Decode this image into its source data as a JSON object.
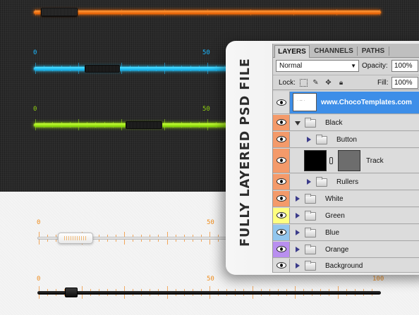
{
  "colors": {
    "orange": "#ff7a10",
    "blue": "#19c0ff",
    "green": "#a6f000",
    "white_track": "#ffffff",
    "black_track": "#000000",
    "selected_layer": "#3d8ee8",
    "eye_orange": "#f49a6a",
    "eye_yellow": "#ffff80",
    "eye_blue": "#92c6ee",
    "eye_purple": "#b98ff0",
    "eye_gray": "#dcdcdc"
  },
  "sliders": {
    "orange": {
      "value_fraction": 0.03,
      "labels": []
    },
    "blue": {
      "labels": [
        "0",
        "50"
      ],
      "value_fraction": 0.16
    },
    "green": {
      "labels": [
        "0",
        "50"
      ],
      "value_fraction": 0.3
    },
    "white": {
      "labels": [
        "0",
        "50"
      ],
      "value_fraction": 0.1
    },
    "black": {
      "labels": [
        "0",
        "50",
        "100"
      ],
      "value_fraction": 0.1
    }
  },
  "promo": {
    "side_title": "FULLY LAYERED PSD FILE"
  },
  "panel": {
    "tabs": [
      "LAYERS",
      "CHANNELS",
      "PATHS"
    ],
    "blend_mode": "Normal",
    "opacity_label": "Opacity:",
    "opacity_value": "100%",
    "lock_label": "Lock:",
    "fill_label": "Fill:",
    "fill_value": "100%",
    "lock_icons": [
      "lock-transparent-icon",
      "lock-brush-icon",
      "lock-move-icon",
      "lock-all-icon"
    ],
    "layers": [
      {
        "name": "www.ChocoTemplates.com",
        "selected": true,
        "eye_color": "#dcdcdc",
        "type": "thumb"
      },
      {
        "name": "Black",
        "eye_color": "#f49a6a",
        "type": "folder-open"
      },
      {
        "name": "Button",
        "eye_color": "#f49a6a",
        "type": "folder-nested"
      },
      {
        "name": "Track",
        "eye_color": "#f49a6a",
        "type": "layer-mask"
      },
      {
        "name": "Rullers",
        "eye_color": "#f49a6a",
        "type": "folder-nested"
      },
      {
        "name": "White",
        "eye_color": "#f49a6a",
        "type": "folder"
      },
      {
        "name": "Green",
        "eye_color": "#ffff80",
        "type": "folder"
      },
      {
        "name": "Blue",
        "eye_color": "#92c6ee",
        "type": "folder"
      },
      {
        "name": "Orange",
        "eye_color": "#b98ff0",
        "type": "folder"
      },
      {
        "name": "Background",
        "eye_color": "#dcdcdc",
        "type": "folder"
      }
    ]
  }
}
